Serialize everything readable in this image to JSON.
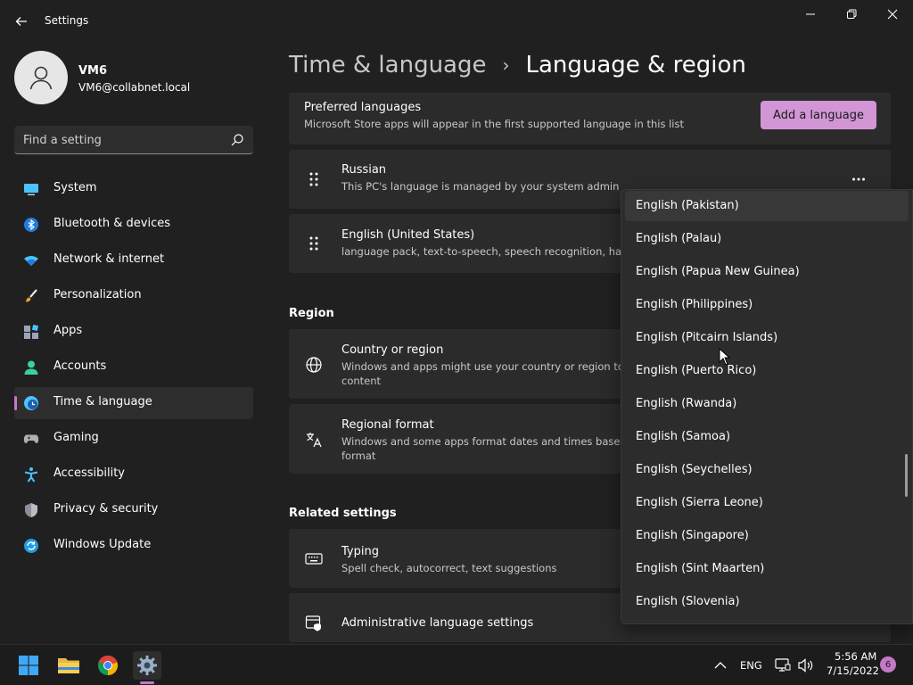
{
  "window": {
    "title": "Settings"
  },
  "user": {
    "name": "VM6",
    "email": "VM6@collabnet.local"
  },
  "search": {
    "placeholder": "Find a setting"
  },
  "sidebar": {
    "items": [
      {
        "label": "System",
        "icon": "system-icon"
      },
      {
        "label": "Bluetooth & devices",
        "icon": "bluetooth-icon"
      },
      {
        "label": "Network & internet",
        "icon": "wifi-icon"
      },
      {
        "label": "Personalization",
        "icon": "brush-icon"
      },
      {
        "label": "Apps",
        "icon": "apps-icon"
      },
      {
        "label": "Accounts",
        "icon": "person-icon"
      },
      {
        "label": "Time & language",
        "icon": "globe-clock-icon",
        "active": true
      },
      {
        "label": "Gaming",
        "icon": "gamepad-icon"
      },
      {
        "label": "Accessibility",
        "icon": "accessibility-icon"
      },
      {
        "label": "Privacy & security",
        "icon": "shield-icon"
      },
      {
        "label": "Windows Update",
        "icon": "update-icon"
      }
    ]
  },
  "breadcrumb": {
    "parent": "Time & language",
    "separator": "›",
    "current": "Language & region"
  },
  "preferred_languages": {
    "title": "Preferred languages",
    "subtitle": "Microsoft Store apps will appear in the first supported language in this list",
    "add_button": "Add a language"
  },
  "languages": [
    {
      "name": "Russian",
      "detail": "This PC's language is managed by your system admin"
    },
    {
      "name": "English (United States)",
      "detail": "language pack, text-to-speech, speech recognition, handw"
    }
  ],
  "region": {
    "section_title": "Region",
    "country": {
      "title": "Country or region",
      "subtitle_line1": "Windows and apps might use your country or region to gi",
      "subtitle_line2": "content"
    },
    "format": {
      "title": "Regional format",
      "subtitle_line1": "Windows and some apps format dates and times based o",
      "subtitle_line2": "format"
    }
  },
  "related": {
    "section_title": "Related settings",
    "typing": {
      "title": "Typing",
      "subtitle": "Spell check, autocorrect, text suggestions"
    },
    "admin": {
      "title": "Administrative language settings"
    }
  },
  "dropdown": {
    "items": [
      "English (Pakistan)",
      "English (Palau)",
      "English (Papua New Guinea)",
      "English (Philippines)",
      "English (Pitcairn Islands)",
      "English (Puerto Rico)",
      "English (Rwanda)",
      "English (Samoa)",
      "English (Seychelles)",
      "English (Sierra Leone)",
      "English (Singapore)",
      "English (Sint Maarten)",
      "English (Slovenia)"
    ],
    "highlighted_index": 0
  },
  "taskbar": {
    "language": "ENG",
    "time": "5:56 AM",
    "date": "7/15/2022",
    "notification_count": "6"
  },
  "colors": {
    "accent": "#c478c8",
    "button": "#d296d6",
    "background": "#202020",
    "card": "#2b2b2b"
  }
}
